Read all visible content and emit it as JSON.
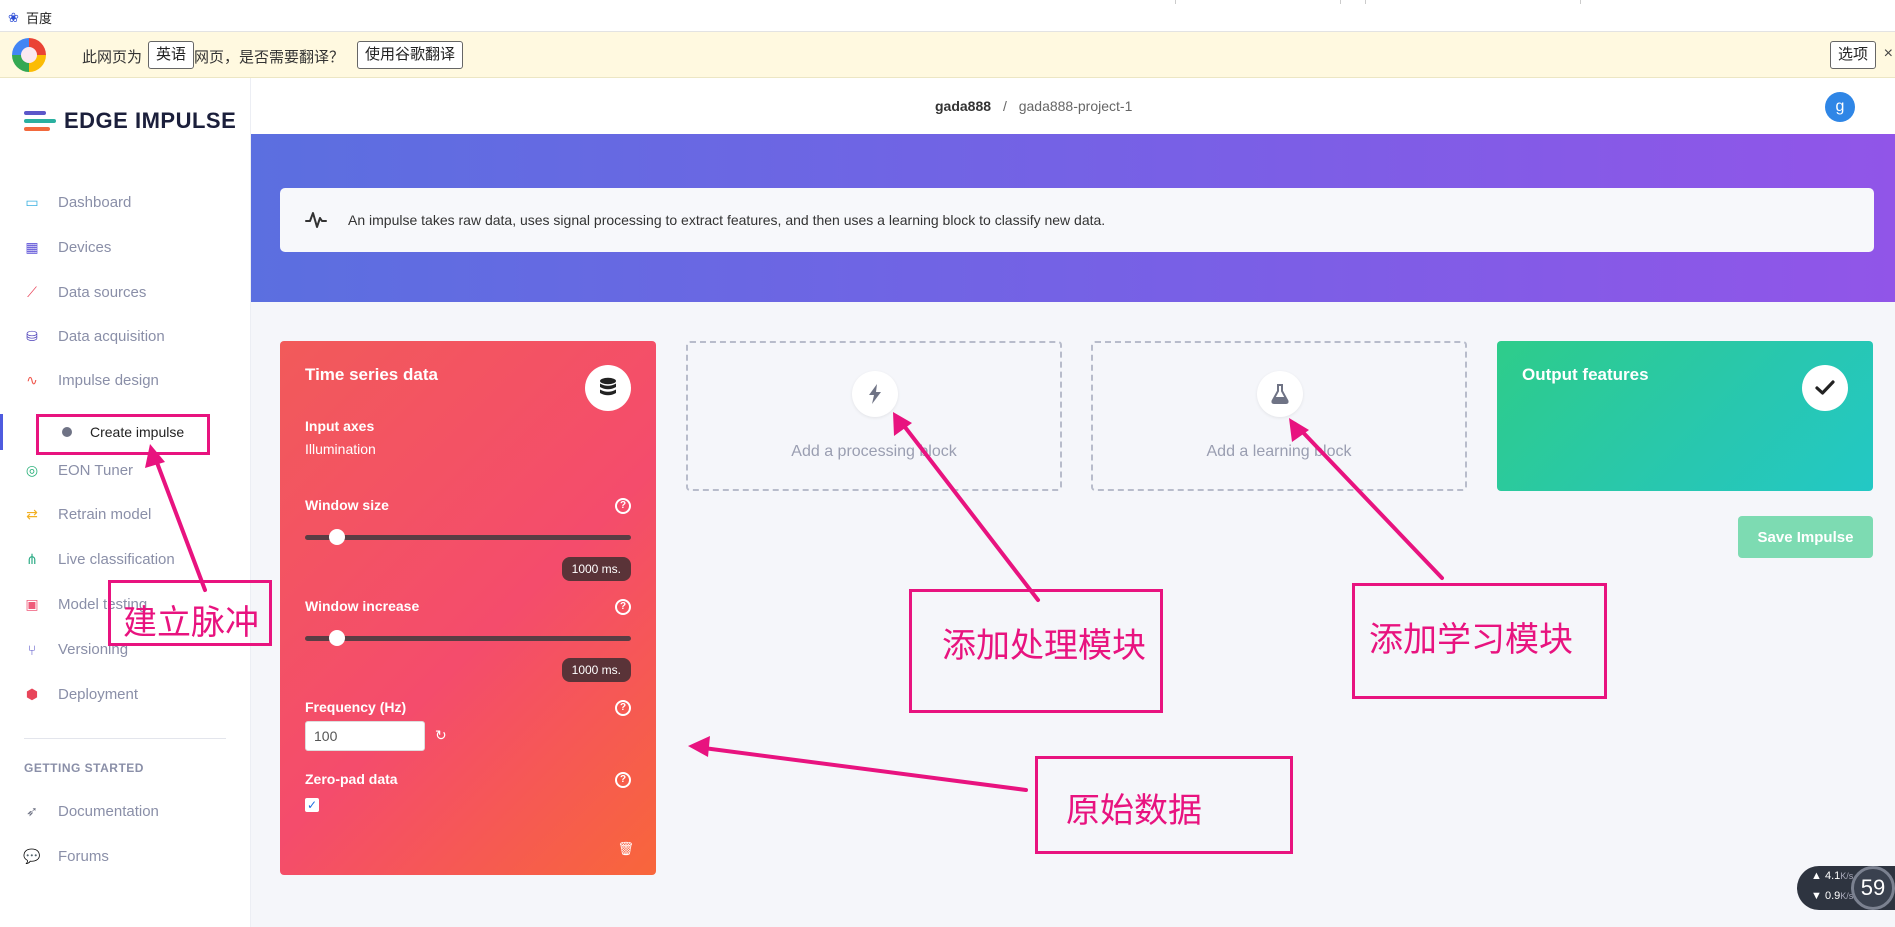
{
  "browser": {
    "tab_title": "百度"
  },
  "translate_bar": {
    "prefix": "此网页为",
    "language": "英语",
    "question": "网页，是否需要翻译？",
    "translate_button": "使用谷歌翻译",
    "options_button": "选项",
    "close": "×"
  },
  "sidebar": {
    "brand": "EDGE IMPULSE",
    "items": [
      {
        "label": "Dashboard",
        "icon": "monitor-icon",
        "color": "#3ab0e0"
      },
      {
        "label": "Devices",
        "icon": "chip-icon",
        "color": "#5b4fd6"
      },
      {
        "label": "Data sources",
        "icon": "wand-icon",
        "color": "#e8455a"
      },
      {
        "label": "Data acquisition",
        "icon": "database-icon",
        "color": "#4b3fb8"
      },
      {
        "label": "Impulse design",
        "icon": "pulse-icon",
        "color": "#f0594f"
      },
      {
        "label": "EON Tuner",
        "icon": "compass-icon",
        "color": "#2ab07a"
      },
      {
        "label": "Retrain model",
        "icon": "shuffle-icon",
        "color": "#f2b023"
      },
      {
        "label": "Live classification",
        "icon": "branch-icon",
        "color": "#2aaa84"
      },
      {
        "label": "Model testing",
        "icon": "clipboard-check-icon",
        "color": "#ef5b7a"
      },
      {
        "label": "Versioning",
        "icon": "fork-icon",
        "color": "#5b57c9"
      },
      {
        "label": "Deployment",
        "icon": "cube-icon",
        "color": "#e8455a"
      }
    ],
    "sub_item": "Create impulse",
    "section_heading": "GETTING STARTED",
    "bottom_items": [
      {
        "label": "Documentation",
        "icon": "rocket-icon"
      },
      {
        "label": "Forums",
        "icon": "chat-icon"
      }
    ]
  },
  "header": {
    "user": "gada888",
    "separator": "/",
    "project": "gada888-project-1",
    "avatar_letter": "g"
  },
  "info": {
    "message": "An impulse takes raw data, uses signal processing to extract features, and then uses a learning block to classify new data."
  },
  "time_series": {
    "title": "Time series data",
    "input_axes_label": "Input axes",
    "input_axes_value": "Illumination",
    "window_size_label": "Window size",
    "window_size_value": "1000 ms.",
    "window_increase_label": "Window increase",
    "window_increase_value": "1000 ms.",
    "frequency_label": "Frequency (Hz)",
    "frequency_value": "100",
    "zero_pad_label": "Zero-pad data",
    "zero_pad_checked": true,
    "help": "?"
  },
  "processing_block": {
    "label": "Add a processing block"
  },
  "learning_block": {
    "label": "Add a learning block"
  },
  "output": {
    "title": "Output features"
  },
  "save_button": "Save Impulse",
  "annotations": {
    "create_pulse": "建立脉冲",
    "add_processing": "添加处理模块",
    "add_learning": "添加学习模块",
    "raw_data": "原始数据",
    "color": "#e8137f"
  },
  "net_widget": {
    "up": "4.1",
    "down": "0.9",
    "unit": "K/s",
    "percent": "59"
  }
}
